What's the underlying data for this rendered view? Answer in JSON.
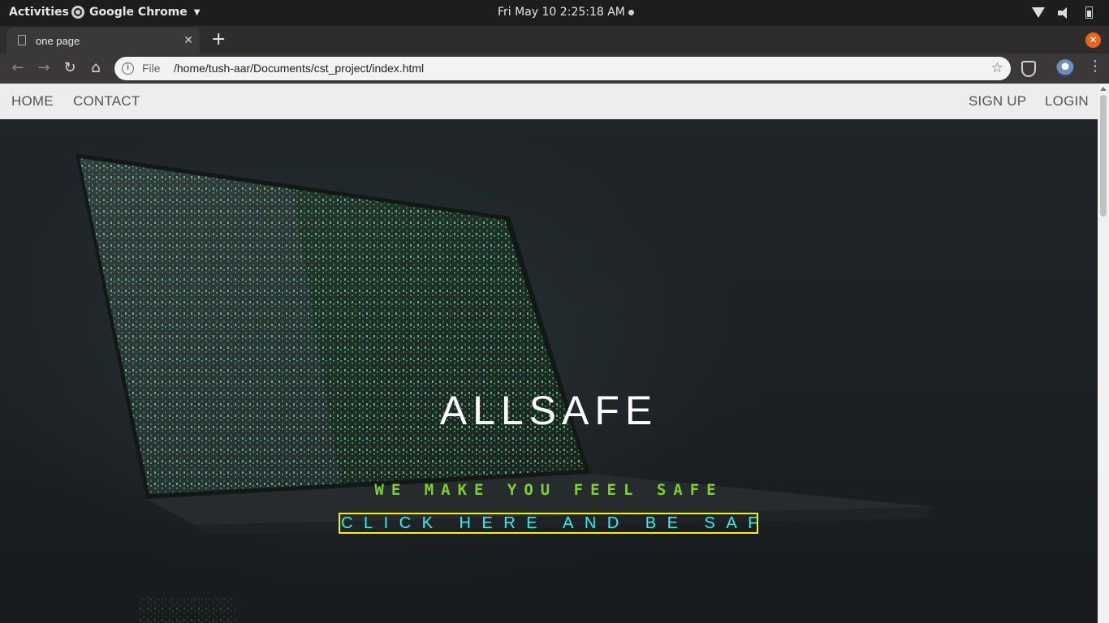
{
  "system_bar": {
    "activities": "Activities",
    "app_name": "Google Chrome",
    "clock": "Fri May 10   2:25:18 AM"
  },
  "browser": {
    "tab_title": "one page",
    "omnibox_scheme": "File",
    "url": "/home/tush-aar/Documents/cst_project/index.html"
  },
  "site": {
    "nav": {
      "home": "HOME",
      "contact": "CONTACT",
      "signup": "SIGN UP",
      "login": "LOGIN"
    },
    "hero": {
      "title": "ALLSAFE",
      "tagline": "WE MAKE YOU FEEL SAFE",
      "cta": "CLICK HERE AND BE SAFE"
    }
  },
  "colors": {
    "tagline": "#7ed321",
    "cta_text": "#2ef0f0",
    "cta_border": "#f3f300",
    "nav_bg": "#ededed"
  },
  "icons": [
    "chrome-icon",
    "wifi-icon",
    "volume-icon",
    "battery-icon",
    "page-icon",
    "close-tab-icon",
    "new-tab-icon",
    "window-close-icon",
    "back-icon",
    "forward-icon",
    "reload-icon",
    "home-icon",
    "info-icon",
    "bookmark-star-icon",
    "shield-extension-icon",
    "profile-avatar",
    "menu-kebab-icon"
  ]
}
